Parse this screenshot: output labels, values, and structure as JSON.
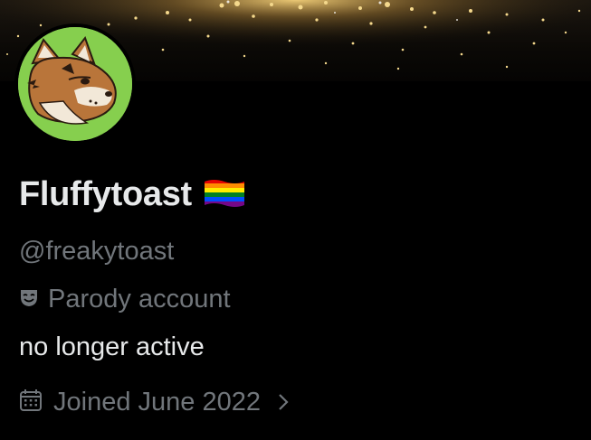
{
  "profile": {
    "display_name": "Fluffytoast",
    "handle": "@freakytoast",
    "label": "Parody account",
    "bio": "no longer active",
    "joined": "Joined June 2022"
  },
  "icons": {
    "flag": "rainbow-flag-icon",
    "label": "theater-mask-icon",
    "joined": "calendar-icon",
    "more": "chevron-right-icon"
  },
  "colors": {
    "background": "#000000",
    "primary_text": "#e7e9ea",
    "secondary_text": "#71767b",
    "avatar_bg": "#86cf4e"
  }
}
